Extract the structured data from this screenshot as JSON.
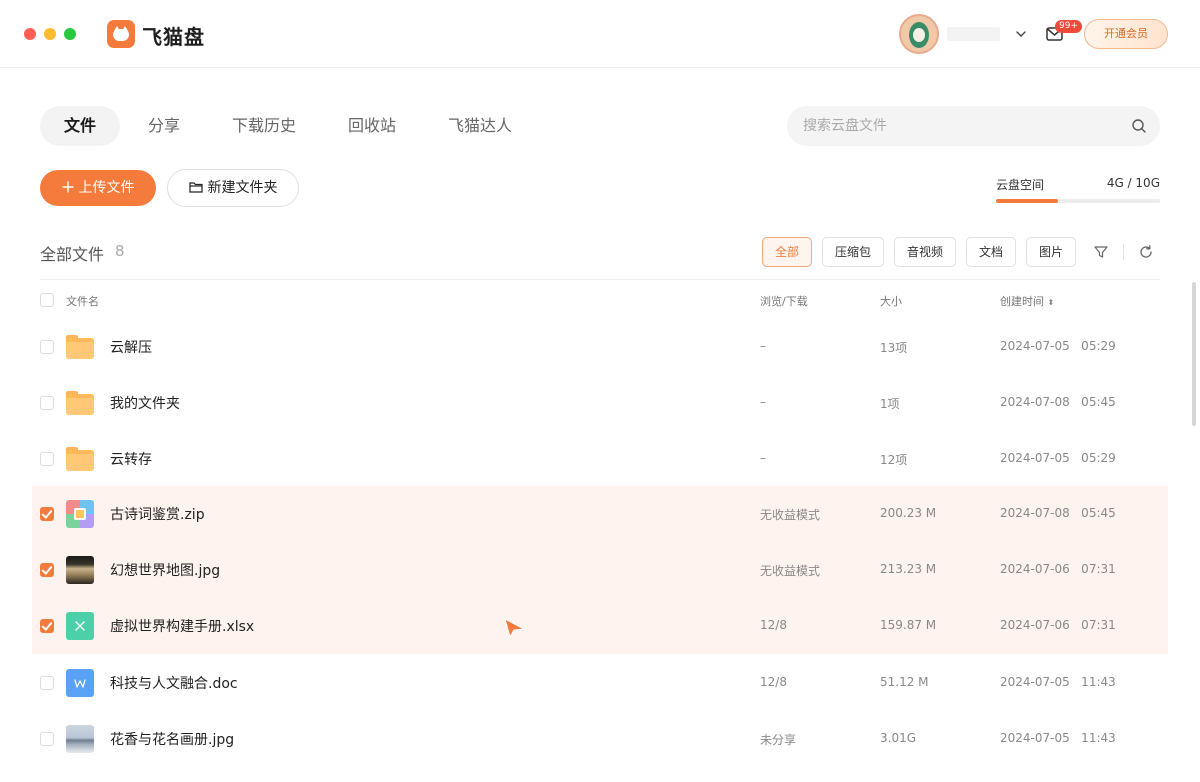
{
  "app": {
    "name": "飞猫盘",
    "mail_badge": "99+",
    "vip_button": "开通会员"
  },
  "tabs": [
    "文件",
    "分享",
    "下载历史",
    "回收站",
    "飞猫达人"
  ],
  "search": {
    "placeholder": "搜索云盘文件"
  },
  "actions": {
    "upload": "上传文件",
    "new_folder": "新建文件夹"
  },
  "storage": {
    "label": "云盘空间",
    "value": "4G / 10G",
    "used_fraction": 0.38
  },
  "files": {
    "title": "全部文件",
    "count": "8",
    "filters": [
      "全部",
      "压缩包",
      "音视频",
      "文档",
      "图片"
    ]
  },
  "table": {
    "headers": {
      "name": "文件名",
      "views": "浏览/下载",
      "size": "大小",
      "created": "创建时间"
    },
    "sort_indicator": "⬍",
    "rows": [
      {
        "name": "云解压",
        "views": "–",
        "size": "13项",
        "created": "2024-07-05   05:29",
        "type": "folder",
        "selected": false
      },
      {
        "name": "我的文件夹",
        "views": "–",
        "size": "1项",
        "created": "2024-07-08   05:45",
        "type": "folder",
        "selected": false
      },
      {
        "name": "云转存",
        "views": "–",
        "size": "12项",
        "created": "2024-07-05   05:29",
        "type": "folder",
        "selected": false
      },
      {
        "name": "古诗词鉴赏.zip",
        "views": "无收益模式",
        "size": "200.23 M",
        "created": "2024-07-08   05:45",
        "type": "zip",
        "selected": true
      },
      {
        "name": "幻想世界地图.jpg",
        "views": "无收益模式",
        "size": "213.23 M",
        "created": "2024-07-06   07:31",
        "type": "image",
        "selected": true
      },
      {
        "name": "虚拟世界构建手册.xlsx",
        "views": "12/8",
        "size": "159.87 M",
        "created": "2024-07-06   07:31",
        "type": "xlsx",
        "selected": true
      },
      {
        "name": "科技与人文融合.doc",
        "views": "12/8",
        "size": "51.12 M",
        "created": "2024-07-05   11:43",
        "type": "doc",
        "selected": false
      },
      {
        "name": "花香与花名画册.jpg",
        "views": "未分享",
        "size": "3.01G",
        "created": "2024-07-05   11:43",
        "type": "image",
        "selected": false
      }
    ]
  },
  "colors": {
    "accent": "#f57b3c",
    "selected_row": "#fff3ef"
  }
}
